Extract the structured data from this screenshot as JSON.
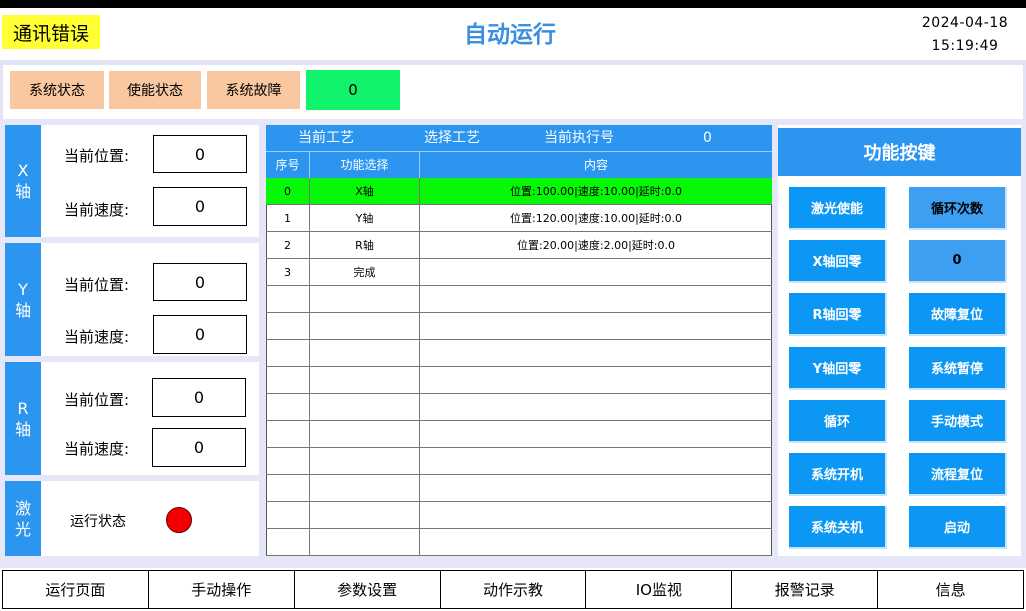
{
  "header": {
    "comm_error": "通讯错误",
    "title": "自动运行",
    "date": "2024-04-18",
    "time": "15:19:49"
  },
  "status_bar": {
    "buttons": [
      "系统状态",
      "使能状态",
      "系统故障"
    ],
    "value": "0"
  },
  "axes": [
    {
      "label": "X\n轴",
      "pos_label": "当前位置:",
      "pos_value": "0",
      "speed_label": "当前速度:",
      "speed_value": "0"
    },
    {
      "label": "Y\n轴",
      "pos_label": "当前位置:",
      "pos_value": "0",
      "speed_label": "当前速度:",
      "speed_value": "0"
    },
    {
      "label": "R\n轴",
      "pos_label": "当前位置:",
      "pos_value": "0",
      "speed_label": "当前速度:",
      "speed_value": "0"
    }
  ],
  "laser": {
    "label": "激\n光",
    "status_label": "运行状态",
    "status_color": "#f20000"
  },
  "process": {
    "current_process": "当前工艺",
    "select_process": "选择工艺",
    "current_exec_label": "当前执行号",
    "current_exec_value": "0",
    "columns": [
      "序号",
      "功能选择",
      "内容"
    ],
    "rows": [
      {
        "index": "0",
        "function": "X轴",
        "content": "位置:100.00|速度:10.00|延时:0.0"
      },
      {
        "index": "1",
        "function": "Y轴",
        "content": "位置:120.00|速度:10.00|延时:0.0"
      },
      {
        "index": "2",
        "function": "R轴",
        "content": "位置:20.00|速度:2.00|延时:0.0"
      },
      {
        "index": "3",
        "function": "完成",
        "content": ""
      }
    ],
    "active_row_color": "#06f806"
  },
  "functions": {
    "title": "功能按键",
    "left": [
      "激光使能",
      "X轴回零",
      "R轴回零",
      "Y轴回零",
      "循环",
      "系统开机",
      "系统关机"
    ],
    "right": [
      "循环次数",
      "0",
      "故障复位",
      "系统暂停",
      "手动模式",
      "流程复位",
      "启动"
    ]
  },
  "nav": [
    "运行页面",
    "手动操作",
    "参数设置",
    "动作示教",
    "IO监视",
    "报警记录",
    "信息"
  ],
  "colors": {
    "accent": "#2b95ef",
    "status_orange": "#f9c8a0",
    "status_green": "#11f36a",
    "warning_yellow": "#ffff33"
  }
}
